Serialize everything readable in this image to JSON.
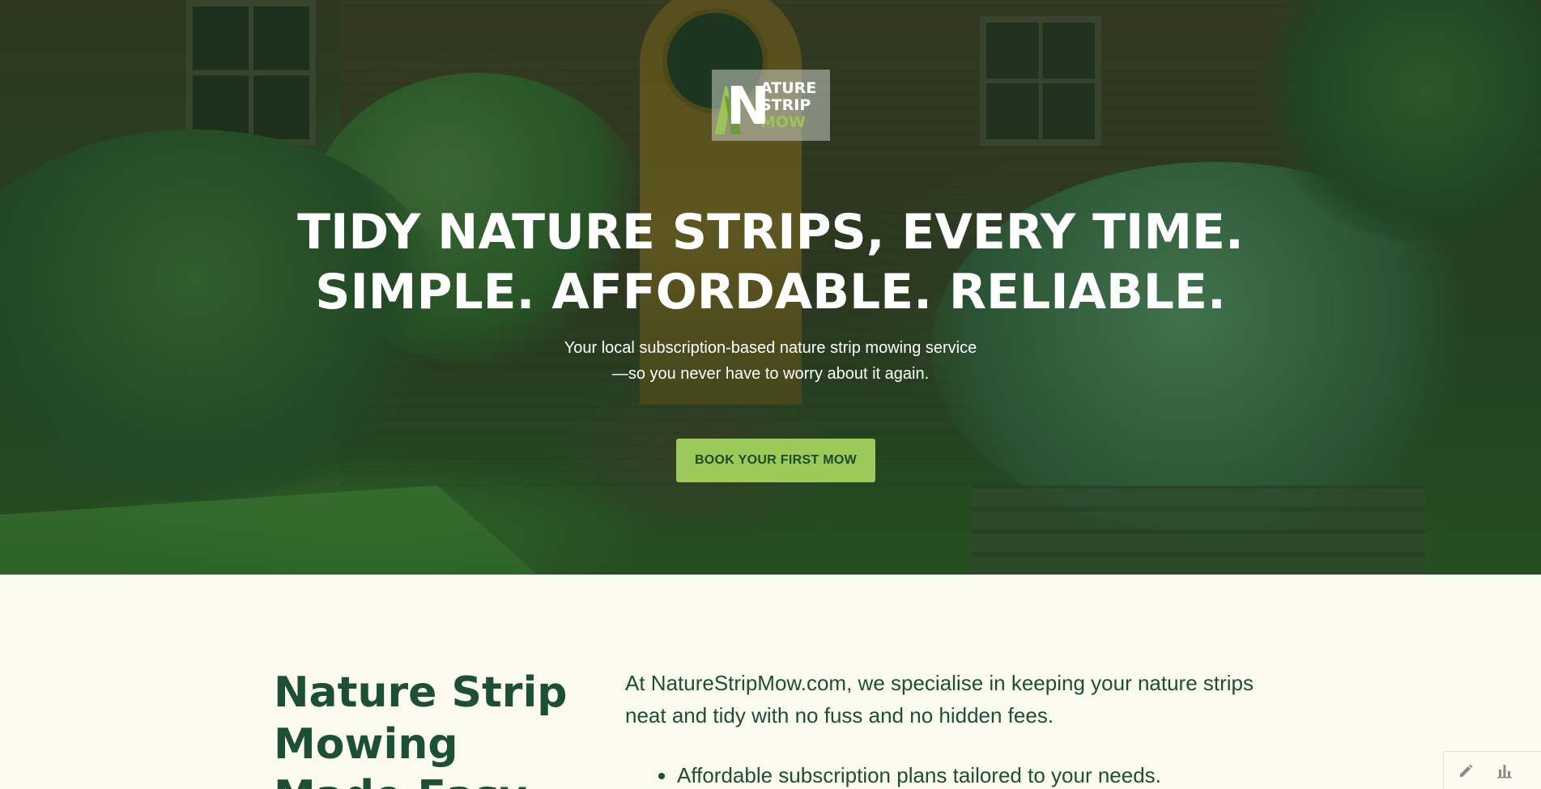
{
  "brand": {
    "logo_letter": "N",
    "logo_lines": [
      "ATURE",
      "STRIP",
      "MOW"
    ],
    "green": "#9cc95a",
    "dark_green": "#1c4f34"
  },
  "hero": {
    "headline_line1": "TIDY NATURE STRIPS, EVERY TIME.",
    "headline_line2": "SIMPLE. AFFORDABLE. RELIABLE.",
    "sub_line1": "Your local subscription-based nature strip mowing service",
    "sub_line2": "—so you never have to worry about it again.",
    "cta_label": "BOOK YOUR FIRST MOW"
  },
  "about": {
    "title": "Nature Strip Mowing Made Easy",
    "intro": "At NatureStripMow.com, we specialise in keeping your nature strips neat and tidy with no fuss and no hidden fees.",
    "bullets": [
      "Affordable subscription plans tailored to your needs."
    ]
  },
  "tools": {
    "edit_icon": "pencil-icon",
    "stats_icon": "bar-chart-icon"
  }
}
